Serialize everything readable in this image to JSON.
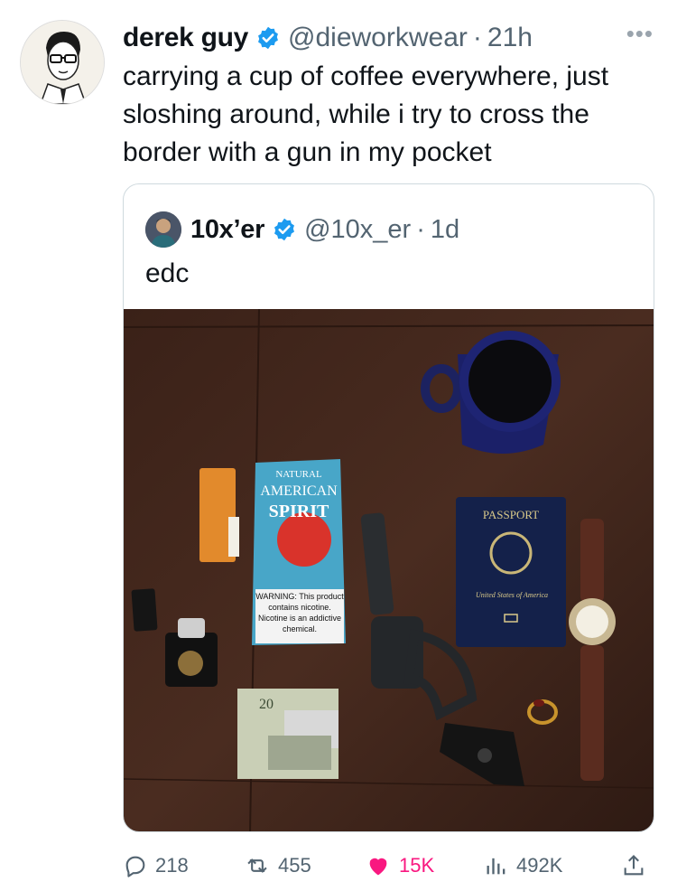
{
  "tweet": {
    "author_name": "derek guy",
    "handle": "@dieworkwear",
    "separator": "·",
    "time": "21h",
    "more_icon": "more-icon",
    "text": "carrying a cup of coffee everywhere, just sloshing around, while i try to cross the border with a gun in my pocket"
  },
  "quote": {
    "author_name": "10x’er",
    "handle": "@10x_er",
    "separator": "·",
    "time": "1d",
    "text": "edc",
    "photo": {
      "tobacco_brand_top": "NATURAL",
      "tobacco_brand_mid": "AMERICAN",
      "tobacco_brand_bottom": "SPIRIT",
      "tobacco_warning": "WARNING: This product contains nicotine. Nicotine is an addictive chemical.",
      "passport_title": "PASSPORT",
      "passport_country": "United States of America",
      "banknote_value": "20"
    }
  },
  "actions": {
    "replies": "218",
    "retweets": "455",
    "likes": "15K",
    "views": "492K"
  },
  "colors": {
    "verified": "#1d9bf0",
    "like": "#f91880",
    "muted": "#536471",
    "border": "#cfd9de"
  }
}
